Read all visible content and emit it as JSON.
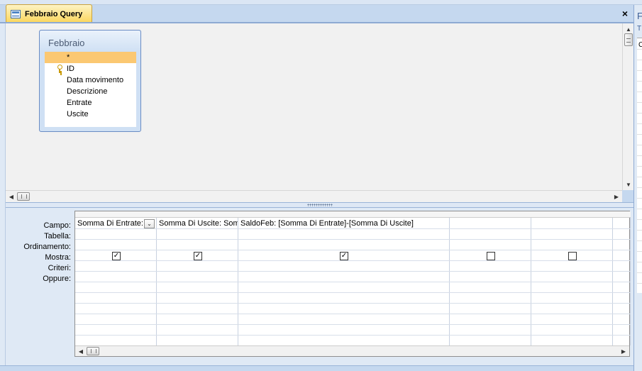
{
  "tab": {
    "label": "Febbraio Query"
  },
  "close": {
    "glyph": "×"
  },
  "table_box": {
    "title": "Febbraio",
    "fields": [
      {
        "label": "*",
        "selected": true,
        "key": false
      },
      {
        "label": "ID",
        "selected": false,
        "key": true
      },
      {
        "label": "Data movimento",
        "selected": false,
        "key": false
      },
      {
        "label": "Descrizione",
        "selected": false,
        "key": false
      },
      {
        "label": "Entrate",
        "selected": false,
        "key": false
      },
      {
        "label": "Uscite",
        "selected": false,
        "key": false
      }
    ]
  },
  "row_labels": [
    "Campo:",
    "Tabella:",
    "Ordinamento:",
    "Mostra:",
    "Criteri:",
    "Oppure:"
  ],
  "columns": [
    {
      "campo": "Somma Di Entrate: Entr",
      "show": true,
      "has_dropdown": true
    },
    {
      "campo": "Somma Di Uscite: Somma",
      "show": true,
      "has_dropdown": false
    },
    {
      "campo": "SaldoFeb: [Somma Di Entrate]-[Somma Di Uscite]",
      "show": true,
      "has_dropdown": false
    },
    {
      "campo": "",
      "show": false,
      "has_dropdown": false
    },
    {
      "campo": "",
      "show": false,
      "has_dropdown": false
    },
    {
      "campo": "",
      "show": false,
      "has_dropdown": false
    }
  ],
  "right_strip": {
    "a": "F",
    "b": "T",
    "c": "C"
  },
  "colors": {
    "tab_bg": "#fbd65c",
    "selected_field": "#fbc872",
    "pane_bg": "#f1f1f1",
    "chrome_blue": "#dfe9f5"
  },
  "icons": {
    "tab": "query-icon",
    "key": "primary-key-icon",
    "close": "close-icon",
    "check": "checkmark-icon"
  }
}
